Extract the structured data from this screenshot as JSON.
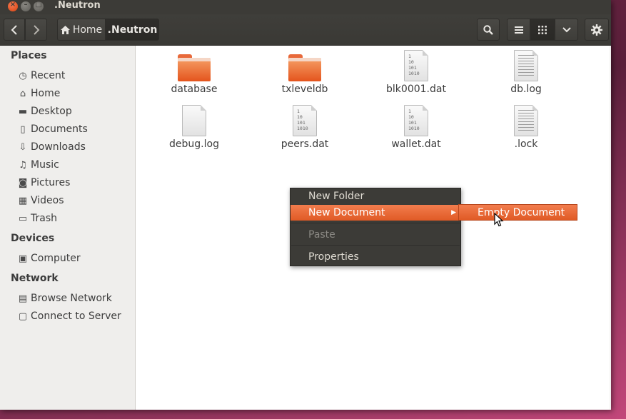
{
  "window": {
    "title": ".Neutron"
  },
  "toolbar": {
    "back_icon": "chevron-left-icon",
    "forward_icon": "chevron-right-icon",
    "breadcrumb": [
      {
        "label": "Home",
        "icon": "home-icon"
      },
      {
        "label": ".Neutron"
      }
    ],
    "buttons": [
      "search-icon",
      "list-view-icon",
      "grid-view-icon",
      "chevron-down-icon",
      "gear-icon"
    ]
  },
  "sidebar": {
    "sections": [
      {
        "heading": "Places",
        "items": [
          {
            "label": "Recent",
            "icon": "clock-icon"
          },
          {
            "label": "Home",
            "icon": "home-icon"
          },
          {
            "label": "Desktop",
            "icon": "folder-icon"
          },
          {
            "label": "Documents",
            "icon": "document-icon"
          },
          {
            "label": "Downloads",
            "icon": "download-icon"
          },
          {
            "label": "Music",
            "icon": "music-icon"
          },
          {
            "label": "Pictures",
            "icon": "camera-icon"
          },
          {
            "label": "Videos",
            "icon": "film-icon"
          },
          {
            "label": "Trash",
            "icon": "trash-icon"
          }
        ]
      },
      {
        "heading": "Devices",
        "items": [
          {
            "label": "Computer",
            "icon": "drive-icon"
          }
        ]
      },
      {
        "heading": "Network",
        "items": [
          {
            "label": "Browse Network",
            "icon": "network-icon"
          },
          {
            "label": "Connect to Server",
            "icon": "server-icon"
          }
        ]
      }
    ]
  },
  "files": [
    {
      "name": "database",
      "kind": "folder"
    },
    {
      "name": "txleveldb",
      "kind": "folder"
    },
    {
      "name": "blk0001.dat",
      "kind": "binary"
    },
    {
      "name": "db.log",
      "kind": "text"
    },
    {
      "name": "debug.log",
      "kind": "blank"
    },
    {
      "name": "peers.dat",
      "kind": "binary"
    },
    {
      "name": "wallet.dat",
      "kind": "binary"
    },
    {
      "name": ".lock",
      "kind": "text"
    }
  ],
  "binary_icon_text": "1\n10\n101\n1010",
  "context_menu": {
    "items": [
      {
        "label": "New Folder",
        "state": "normal"
      },
      {
        "label": "New Document",
        "state": "active",
        "has_submenu": true
      },
      {
        "label": "Paste",
        "state": "disabled"
      },
      {
        "label": "Properties",
        "state": "normal"
      }
    ],
    "submenu": {
      "items": [
        {
          "label": "Empty Document",
          "state": "active"
        }
      ]
    }
  },
  "colors": {
    "accent": "#e05a25",
    "titlebar": "#3c3b37",
    "sidebar_bg": "#efeeec",
    "content_bg": "#ffffff"
  }
}
